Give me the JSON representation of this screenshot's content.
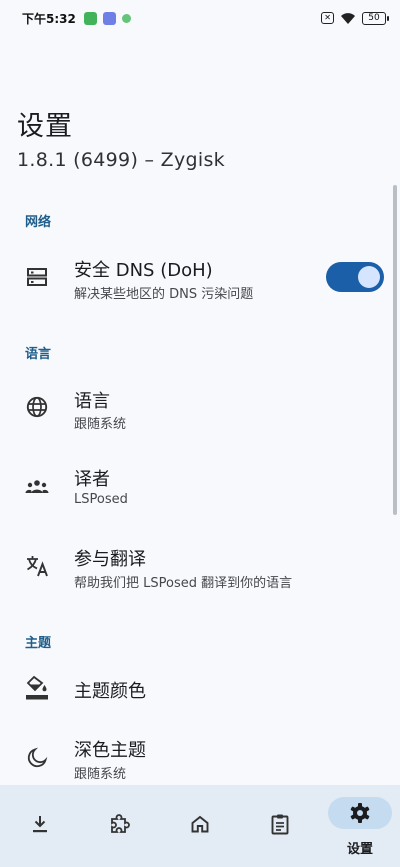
{
  "status_bar": {
    "time": "下午5:32",
    "battery": "50"
  },
  "header": {
    "title": "设置",
    "subtitle": "1.8.1 (6499) – Zygisk"
  },
  "sections": {
    "network": {
      "header": "网络",
      "secure_dns": {
        "label": "安全 DNS (DoH)",
        "desc": "解决某些地区的 DNS 污染问题",
        "enabled": true
      }
    },
    "language": {
      "header": "语言",
      "language_item": {
        "label": "语言",
        "desc": "跟随系统"
      },
      "translators_item": {
        "label": "译者",
        "desc": "LSPosed"
      },
      "translate_item": {
        "label": "参与翻译",
        "desc": "帮助我们把 LSPosed 翻译到你的语言"
      }
    },
    "theme": {
      "header": "主题",
      "theme_color": {
        "label": "主题颜色"
      },
      "dark_theme": {
        "label": "深色主题",
        "desc": "跟随系统"
      }
    }
  },
  "bottom_nav": {
    "items": [
      {
        "icon": "download-icon"
      },
      {
        "icon": "puzzle-icon"
      },
      {
        "icon": "home-icon"
      },
      {
        "icon": "clipboard-icon"
      },
      {
        "icon": "gear-icon",
        "label": "设置",
        "active": true
      }
    ]
  },
  "colors": {
    "accent": "#1a5fa8",
    "section_header": "#1f5d8a",
    "nav_background": "#e3ebf4",
    "active_pill": "#c5dbef"
  }
}
